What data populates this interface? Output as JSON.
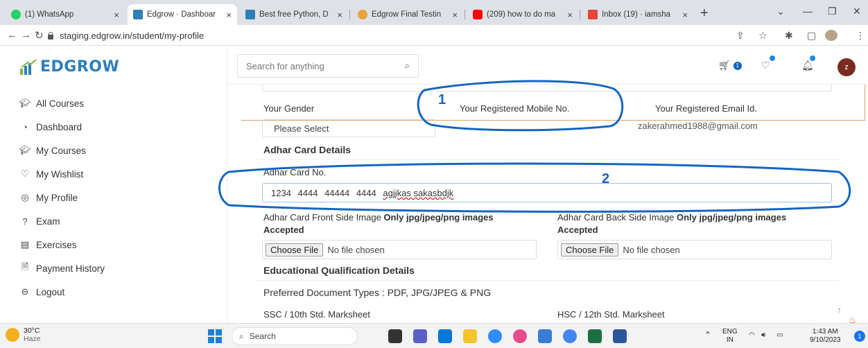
{
  "browser": {
    "tabs": [
      {
        "title": "(1) WhatsApp",
        "close": "×",
        "color": "#25d366"
      },
      {
        "title": "Edgrow · Dashboar",
        "close": "×",
        "color": "#2c7fb8"
      },
      {
        "title": "Best free Python, D",
        "close": "×",
        "color": "#2c7fb8"
      },
      {
        "title": "Edgrow Final Testin",
        "close": "×",
        "color": "#e8a33d"
      },
      {
        "title": "(209) how to do ma",
        "close": "×",
        "color": "#ff0000"
      },
      {
        "title": "Inbox (19) · iamsha",
        "close": "×",
        "color": "#ea4335"
      }
    ],
    "new_tab": "+",
    "url": "staging.edgrow.in/student/my-profile"
  },
  "sidebar": {
    "logo": "EDGROW",
    "items": [
      {
        "label": "All Courses",
        "icon": "cap-icon"
      },
      {
        "label": "Dashboard",
        "icon": "gauge-icon"
      },
      {
        "label": "My Courses",
        "icon": "cap-icon"
      },
      {
        "label": "My Wishlist",
        "icon": "heart-icon"
      },
      {
        "label": "My Profile",
        "icon": "user-icon"
      },
      {
        "label": "Exam",
        "icon": "question-icon"
      },
      {
        "label": "Exercises",
        "icon": "list-icon"
      },
      {
        "label": "Payment History",
        "icon": "receipt-icon"
      },
      {
        "label": "Logout",
        "icon": "logout-icon"
      }
    ]
  },
  "header": {
    "search_placeholder": "Search for anything",
    "cart_count": "1",
    "avatar_letter": "z"
  },
  "form": {
    "gender_label": "Your Gender",
    "mobile_label": "Your Registered Mobile No.",
    "email_label": "Your Registered Email Id.",
    "gender_value": "Please Select",
    "email_value": "zakerahmed1988@gmail.com",
    "adhar_section": "Adhar Card Details",
    "adhar_no_label": "Adhar Card No.",
    "adhar_value_digits": "1234 4444 44444 4444",
    "adhar_value_text": "agjjkas sakasbdjk",
    "front_label": "Adhar Card Front Side Image",
    "back_label": "Adhar Card Back Side Image",
    "image_note": "Only jpg/jpeg/png images",
    "accepted": "Accepted",
    "choose_file": "Choose File",
    "no_file": "No file chosen",
    "edu_section": "Educational Qualification Details",
    "preferred_types": "Preferred Document Types : PDF, JPG/JPEG & PNG",
    "ssc_label": "SSC / 10th Std. Marksheet",
    "hsc_label": "HSC / 12th Std. Marksheet"
  },
  "annotations": [
    "1",
    "2"
  ],
  "taskbar": {
    "temp": "30°C",
    "weather": "Haze",
    "search": "Search",
    "lang": "ENG",
    "region": "IN",
    "time": "1:43 AM",
    "date": "9/10/2023",
    "notifications": "1"
  },
  "colors": {
    "brand": "#2c7fb8",
    "annotation": "#1565c0",
    "accent_orange": "#d9a36b"
  }
}
